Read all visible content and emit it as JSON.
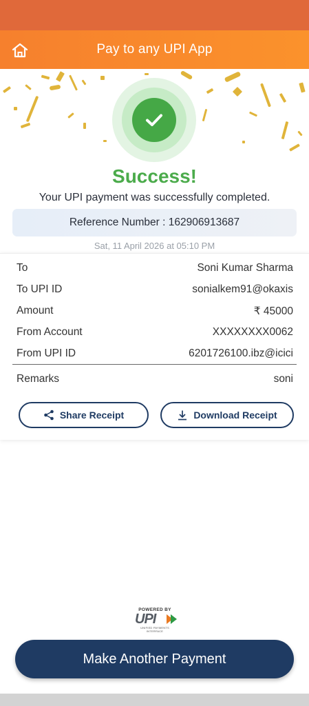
{
  "appbar": {
    "title": "Pay to any UPI App",
    "home_icon": "home-icon"
  },
  "status": {
    "title": "Success!",
    "message": "Your UPI payment was successfully completed.",
    "reference": "Reference Number : 162906913687",
    "datetime": "Sat, 11 April 2026 at 05:10 PM"
  },
  "details": {
    "to_label": "To",
    "to_value": "Soni Kumar Sharma",
    "to_upi_label": "To UPI ID",
    "to_upi_value": "sonialkem91@okaxis",
    "amount_label": "Amount",
    "amount_value": "₹ 45000",
    "from_account_label": "From Account",
    "from_account_value": "XXXXXXXX0062",
    "from_upi_label": "From UPI ID",
    "from_upi_value": "6201726100.ibz@icici",
    "remarks_label": "Remarks",
    "remarks_value": "soni"
  },
  "actions": {
    "share_label": "Share Receipt",
    "download_label": "Download Receipt"
  },
  "footer": {
    "powered_by": "POWERED BY",
    "upi_text": "UPI",
    "upi_subtext": "UNIFIED PAYMENTS INTERFACE",
    "cta_label": "Make Another Payment"
  },
  "colors": {
    "appbar": "#f6802d",
    "status_bar": "#e0693a",
    "success_green": "#4bab4b",
    "navy": "#1f3b63",
    "confetti": "#e0b43a"
  }
}
